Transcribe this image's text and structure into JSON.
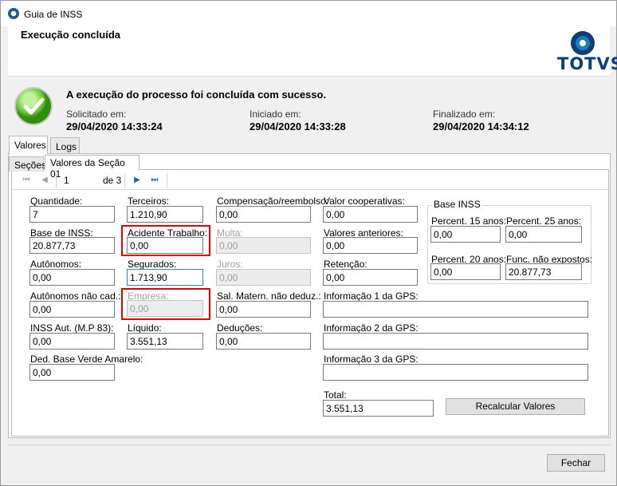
{
  "window": {
    "title": "Guia de INSS"
  },
  "header": {
    "title": "Execução concluída",
    "logo_text": "TOTVS"
  },
  "status": {
    "message": "A execução do processo foi concluída com sucesso.",
    "requested_label": "Solicitado em:",
    "requested_value": "29/04/2020 14:33:24",
    "started_label": "Iniciado em:",
    "started_value": "29/04/2020 14:33:28",
    "finished_label": "Finalizado em:",
    "finished_value": "29/04/2020 14:34:12"
  },
  "tabs": {
    "valores": "Valores",
    "logs": "Logs"
  },
  "subtabs": {
    "secoes": "Seções",
    "valores_secao": "Valores da Seção 01"
  },
  "navigator": {
    "page": "1",
    "of": "de 3"
  },
  "fields": {
    "quantidade": {
      "label": "Quantidade:",
      "value": "7"
    },
    "base_inss": {
      "label": "Base de INSS:",
      "value": "20.877,73"
    },
    "autonomos": {
      "label": "Autônomos:",
      "value": "0,00"
    },
    "autonomos_nao_cad": {
      "label": "Autônomos não cad.:",
      "value": "0,00"
    },
    "inss_aut": {
      "label": "INSS Aut. (M.P 83):",
      "value": "0,00"
    },
    "ded_base_verde": {
      "label": "Ded. Base Verde Amarelo:",
      "value": "0,00"
    },
    "terceiros": {
      "label": "Terceiros:",
      "value": "1.210,90"
    },
    "acidente_trabalho": {
      "label": "Acidente Trabalho:",
      "value": "0,00"
    },
    "segurados": {
      "label": "Segurados:",
      "value": "1.713,90"
    },
    "empresa": {
      "label": "Empresa:",
      "value": "0,00"
    },
    "liquido": {
      "label": "Líquido:",
      "value": "3.551,13"
    },
    "compensacao": {
      "label": "Compensação/reembolso:",
      "value": "0,00"
    },
    "multa": {
      "label": "Multa:",
      "value": "0,00"
    },
    "juros": {
      "label": "Juros:",
      "value": "0,00"
    },
    "sal_matern": {
      "label": "Sal. Matern. não deduz.:",
      "value": "0,00"
    },
    "deducoes": {
      "label": "Deduções:",
      "value": "0,00"
    },
    "valor_cooperativas": {
      "label": "Valor cooperativas:",
      "value": "0,00"
    },
    "valores_anteriores": {
      "label": "Valores anteriores:",
      "value": "0,00"
    },
    "retencao": {
      "label": "Retenção:",
      "value": "0,00"
    },
    "info_gps_1": {
      "label": "Informação 1 da GPS:",
      "value": ""
    },
    "info_gps_2": {
      "label": "Informação 2 da GPS:",
      "value": ""
    },
    "info_gps_3": {
      "label": "Informação 3 da GPS:",
      "value": ""
    },
    "total": {
      "label": "Total:",
      "value": "3.551,13"
    }
  },
  "base_inss_group": {
    "title": "Base INSS",
    "percent_15": {
      "label": "Percent. 15 anos:",
      "value": "0,00"
    },
    "percent_25": {
      "label": "Percent. 25 anos:",
      "value": "0,00"
    },
    "percent_20": {
      "label": "Percent. 20 anos:",
      "value": "0,00"
    },
    "func_nao_expostos": {
      "label": "Func.  não expostos:",
      "value": "20.877,73"
    }
  },
  "buttons": {
    "recalcular": "Recalcular Valores",
    "fechar": "Fechar"
  },
  "colors": {
    "highlight": "#e00000",
    "accent": "#1c5fb4",
    "logo": "#0c3f74"
  }
}
